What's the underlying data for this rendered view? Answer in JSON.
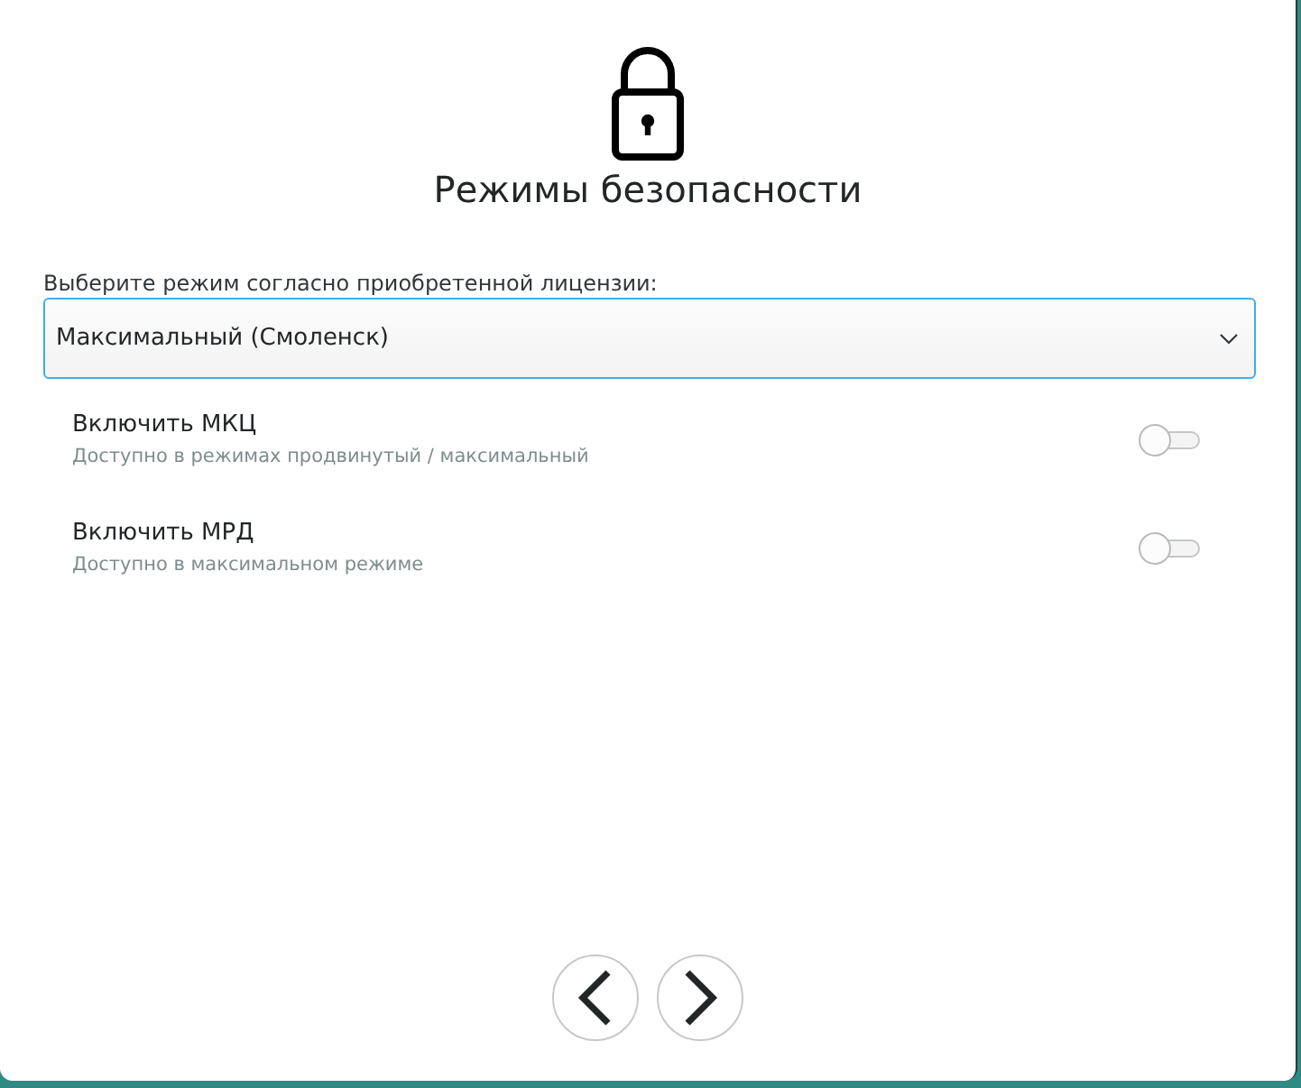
{
  "header": {
    "title": "Режимы безопасности"
  },
  "mode_select": {
    "label": "Выберите режим согласно приобретенной лицензии:",
    "value": "Максимальный (Смоленск)",
    "focused": true
  },
  "options": [
    {
      "title": "Включить МКЦ",
      "description": "Доступно в режимах продвинутый / максимальный",
      "on": false
    },
    {
      "title": "Включить МРД",
      "description": "Доступно в максимальном режиме",
      "on": false
    }
  ],
  "navigation": [
    {
      "kind": "back"
    },
    {
      "kind": "next"
    }
  ]
}
